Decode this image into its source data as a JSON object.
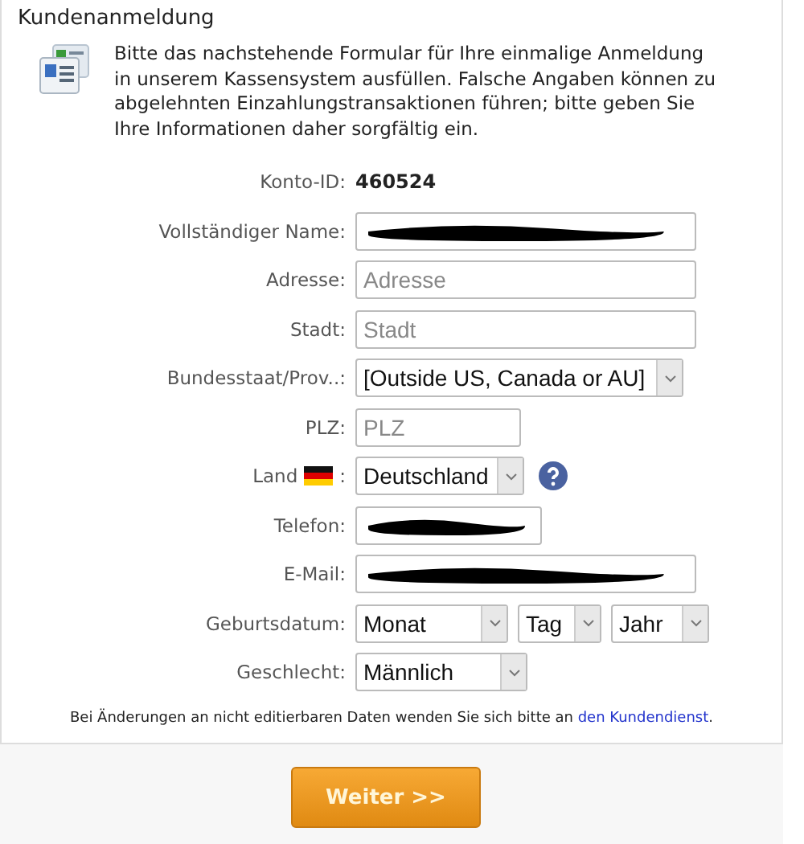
{
  "title": "Kundenanmeldung",
  "intro": "Bitte das nachstehende Formular für Ihre einmalige Anmeldung in unserem Kassensystem ausfüllen. Falsche Angaben können zu abgelehnten Einzahlungstransaktionen führen; bitte geben Sie Ihre Informationen daher sorgfältig ein.",
  "fields": [
    {
      "kind": "static",
      "label": "Konto-ID:",
      "value": "460524"
    },
    {
      "kind": "input",
      "label": "Vollständiger Name:",
      "redacted": true
    },
    {
      "kind": "input",
      "label": "Adresse:",
      "placeholder": "Adresse"
    },
    {
      "kind": "input",
      "label": "Stadt:",
      "placeholder": "Stadt"
    },
    {
      "kind": "select",
      "label": "Bundesstaat/Prov..:",
      "value": "[Outside US, Canada or AU]"
    },
    {
      "kind": "input",
      "label": "PLZ:",
      "placeholder": "PLZ"
    },
    {
      "kind": "country",
      "label": "Land",
      "colon": ":",
      "value": "Deutschland"
    },
    {
      "kind": "input",
      "label": "Telefon:",
      "redacted": true
    },
    {
      "kind": "input",
      "label": "E-Mail:",
      "redacted": true
    },
    {
      "kind": "date",
      "label": "Geburtsdatum:",
      "parts": [
        "Monat",
        "Tag",
        "Jahr"
      ]
    },
    {
      "kind": "select",
      "label": "Geschlecht:",
      "value": "Männlich"
    }
  ],
  "footnote": {
    "text": "Bei Änderungen an nicht editierbaren Daten wenden Sie sich bitte an ",
    "link": "den Kundendienst",
    "end": "."
  },
  "button": "Weiter >>"
}
